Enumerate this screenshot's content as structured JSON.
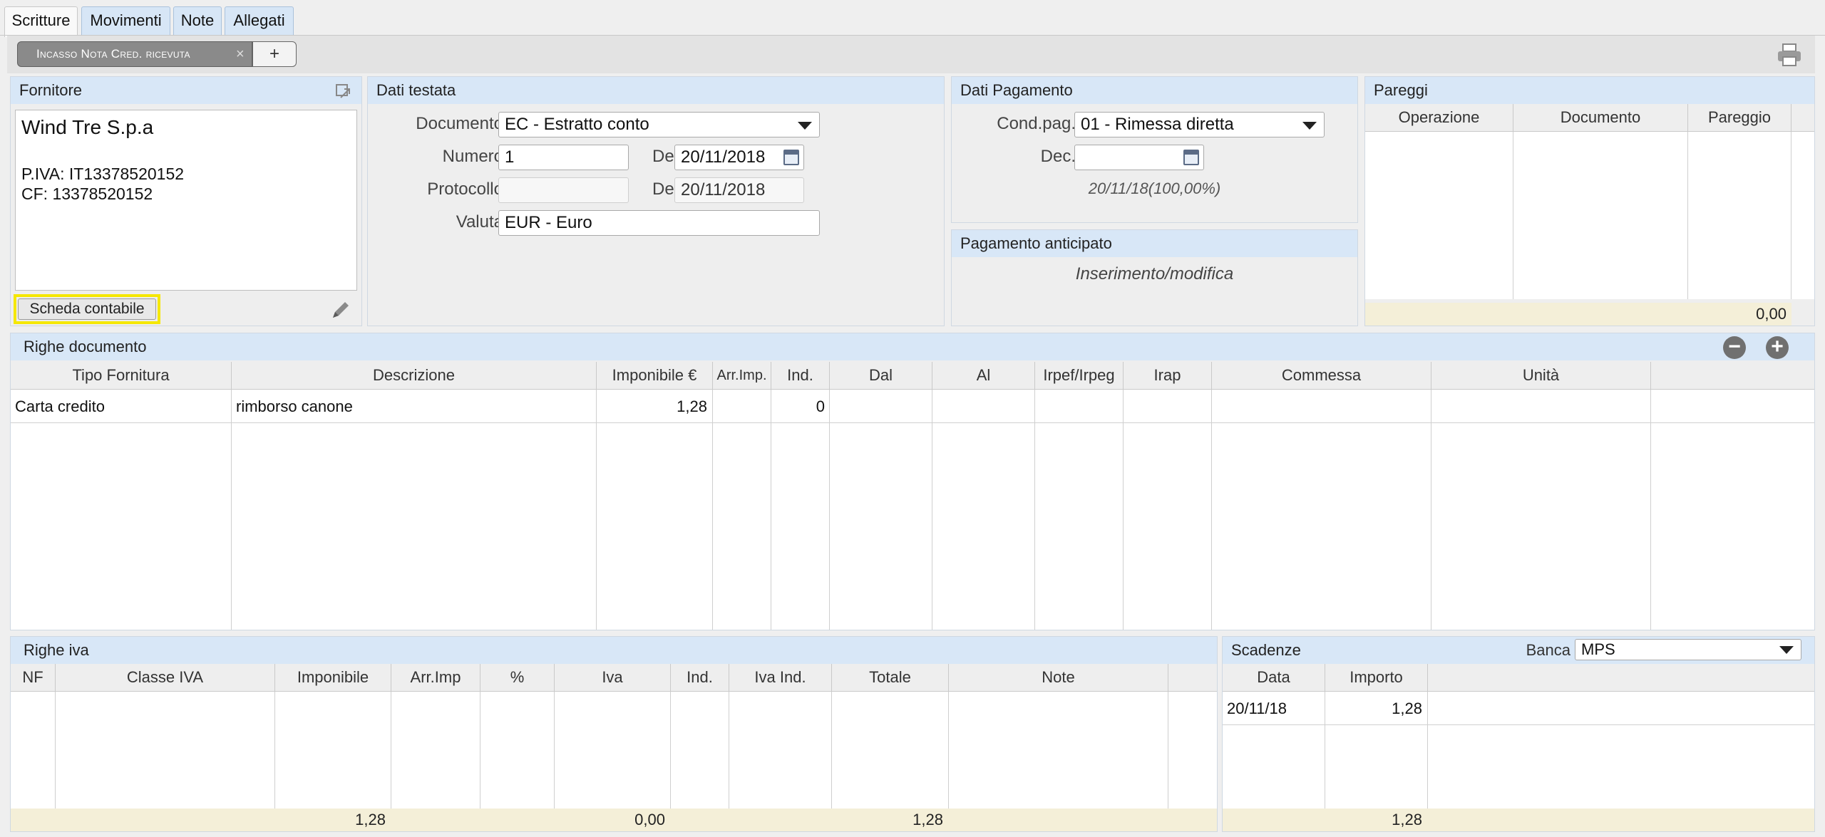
{
  "tabs": [
    "Scritture",
    "Movimenti",
    "Note",
    "Allegati"
  ],
  "doc_tab": {
    "label": "Incasso Nota Cred. ricevuta",
    "close": "×",
    "add": "+"
  },
  "fornitore": {
    "title": "Fornitore",
    "name": "Wind Tre S.p.a",
    "piva": "P.IVA: IT13378520152",
    "cf": "CF: 13378520152",
    "scheda_button": "Scheda contabile"
  },
  "testata": {
    "title": "Dati testata",
    "documento_label": "Documento",
    "documento_value": "EC - Estratto conto",
    "numero_label": "Numero",
    "numero_value": "1",
    "del_label": "Del",
    "del_value": "20/11/2018",
    "protocollo_label": "Protocollo",
    "protocollo_value": "",
    "del2_label": "Del",
    "del2_value": "20/11/2018",
    "valuta_label": "Valuta",
    "valuta_value": "EUR - Euro"
  },
  "pagamento": {
    "title": "Dati Pagamento",
    "cond_label": "Cond.pag.",
    "cond_value": "01 - Rimessa diretta",
    "dec_label": "Dec.",
    "dec_value": "",
    "summary": "20/11/18(100,00%)"
  },
  "anticipato": {
    "title": "Pagamento anticipato",
    "text": "Inserimento/modifica"
  },
  "pareggi": {
    "title": "Pareggi",
    "columns": [
      "Operazione",
      "Documento",
      "Pareggio"
    ],
    "total": "0,00"
  },
  "righe_doc": {
    "title": "Righe documento",
    "columns": [
      "Tipo Fornitura",
      "Descrizione",
      "Imponibile €",
      "Arr.Imp.",
      "Ind.",
      "Dal",
      "Al",
      "Irpef/Irpeg",
      "Irap",
      "Commessa",
      "Unità"
    ],
    "rows": [
      {
        "tipo": "Carta credito",
        "descrizione": "rimborso canone",
        "imponibile": "1,28",
        "arr": "",
        "ind": "0",
        "dal": "",
        "al": "",
        "irpef": "",
        "irap": "",
        "commessa": "",
        "unita": ""
      }
    ],
    "remove_symbol": "−",
    "add_symbol": "+"
  },
  "righe_iva": {
    "title": "Righe iva",
    "columns": [
      "NF",
      "Classe IVA",
      "Imponibile",
      "Arr.Imp",
      "%",
      "Iva",
      "Ind.",
      "Iva Ind.",
      "Totale",
      "Note"
    ],
    "totals": {
      "imponibile": "1,28",
      "iva": "0,00",
      "totale": "1,28"
    }
  },
  "scadenze": {
    "title": "Scadenze",
    "banca_label": "Banca",
    "banca_value": "MPS",
    "columns": [
      "Data",
      "Importo"
    ],
    "rows": [
      {
        "data": "20/11/18",
        "importo": "1,28"
      }
    ],
    "total": "1,28"
  },
  "colors": {
    "panel_header": "#d8e7f7",
    "highlight": "#f5e700",
    "footer": "#f4efd8"
  }
}
